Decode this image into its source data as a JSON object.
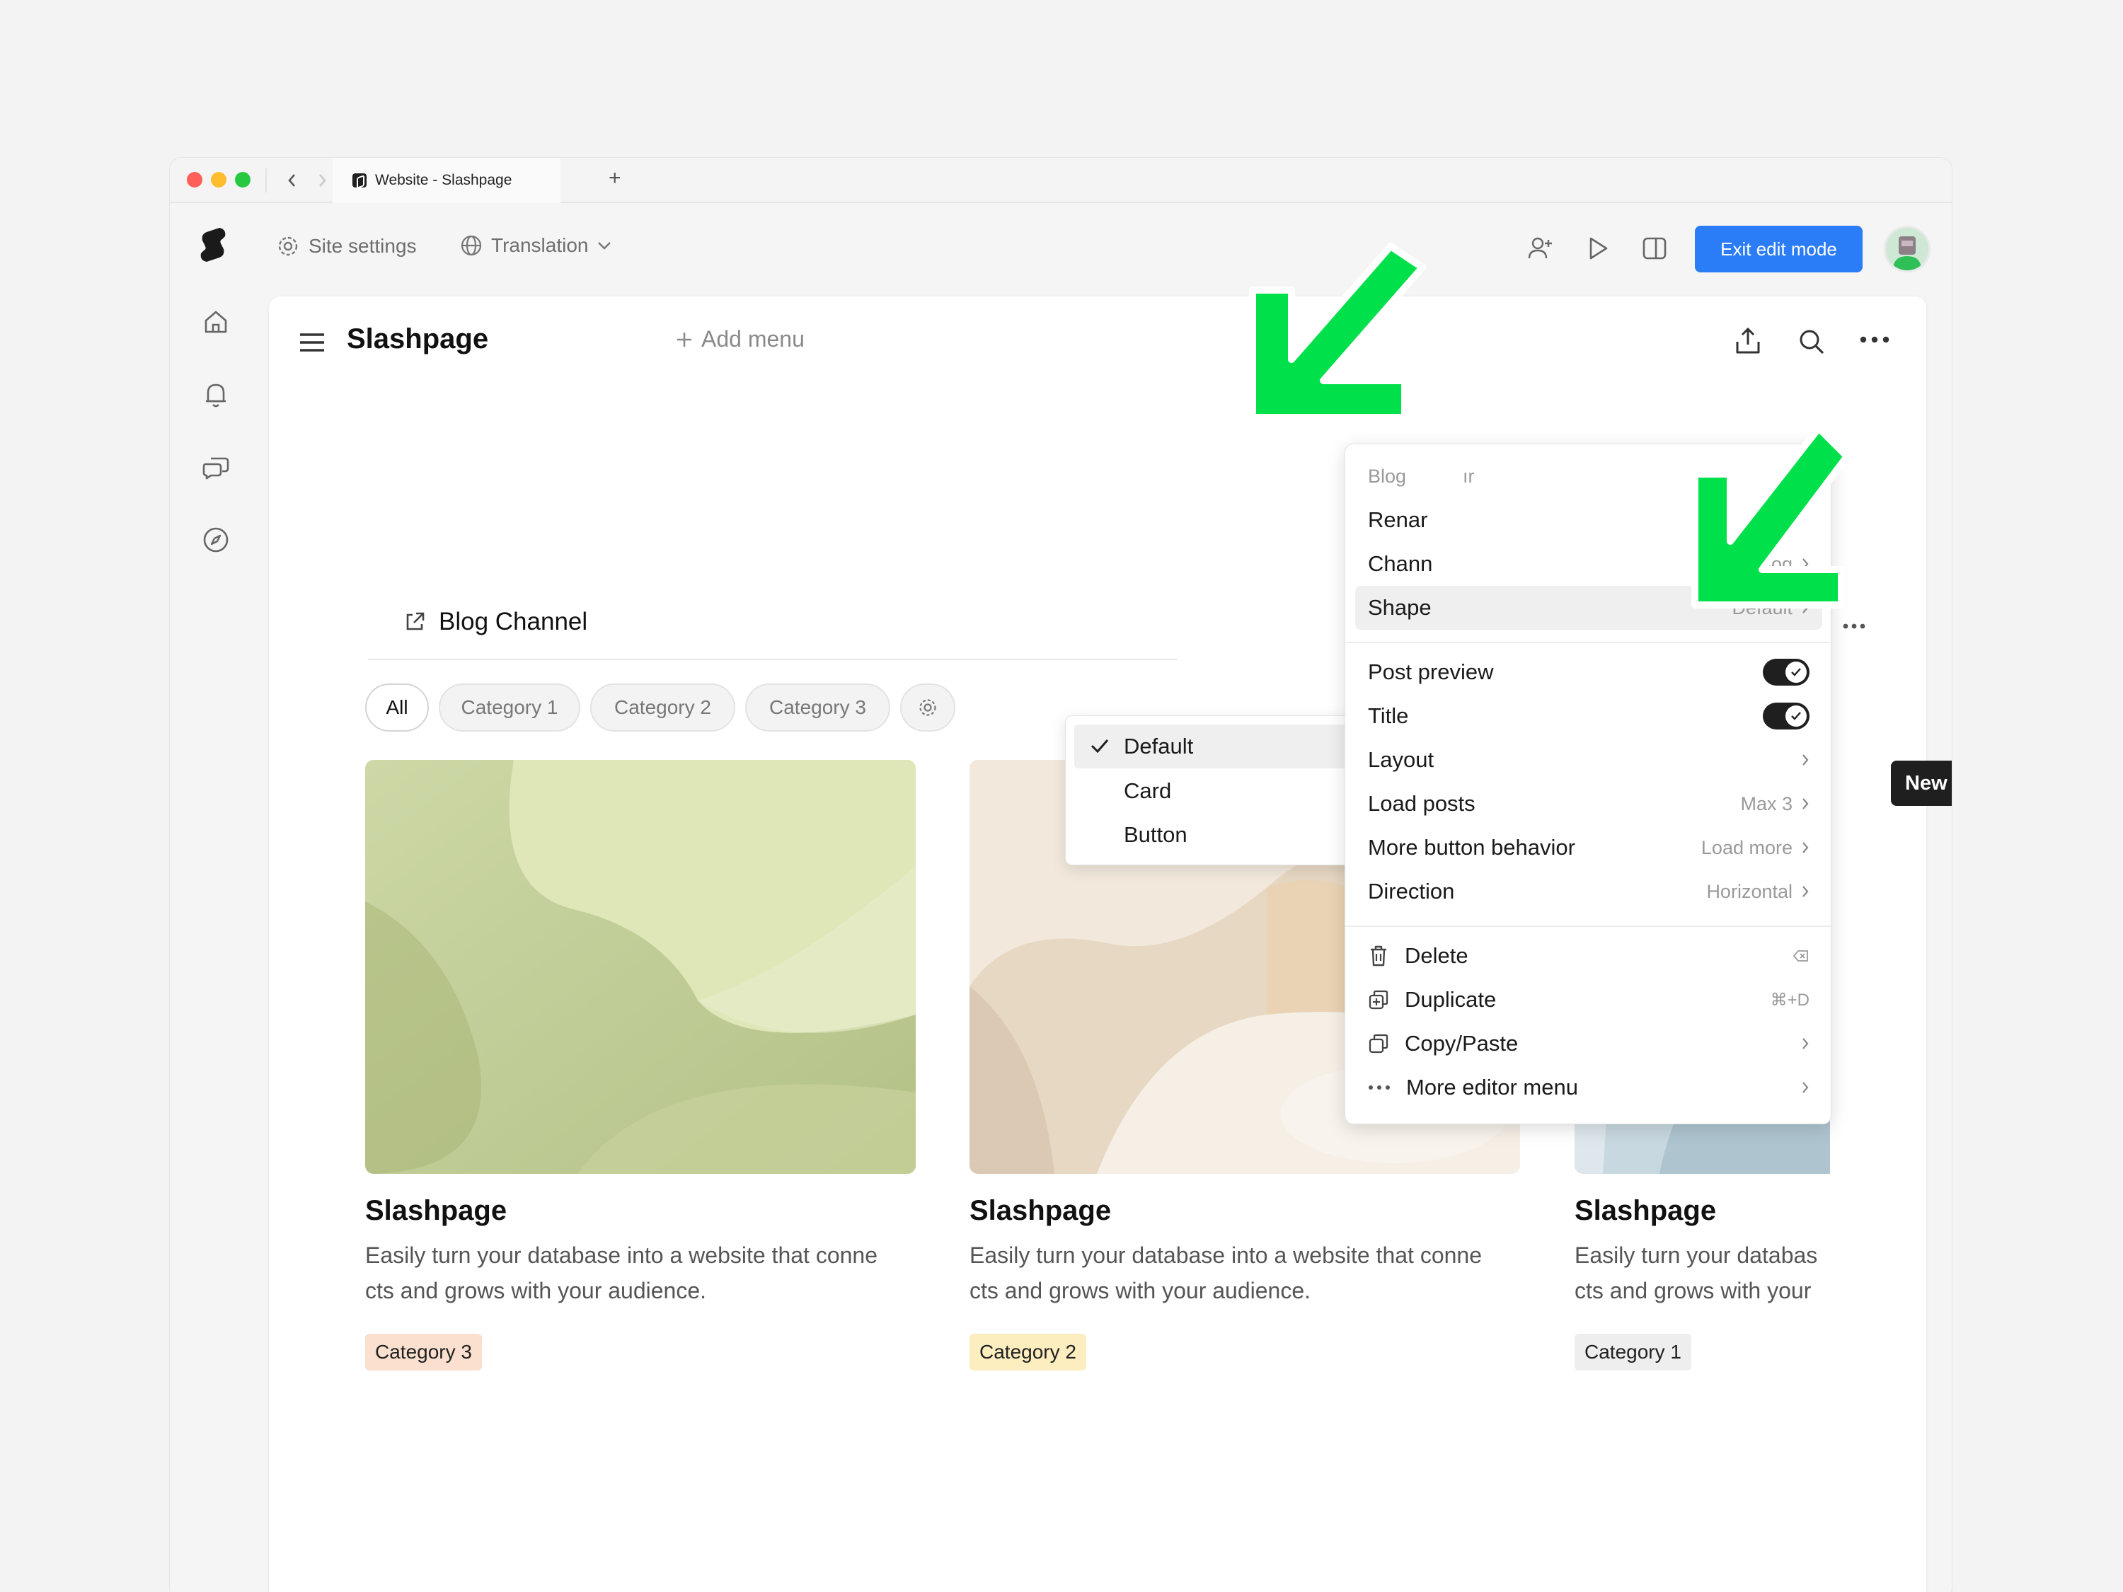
{
  "browser": {
    "tab_title": "Website - Slashpage",
    "new_tab": "+"
  },
  "toolbar": {
    "site_settings": "Site settings",
    "translation": "Translation",
    "exit_edit_mode": "Exit edit mode"
  },
  "page": {
    "title": "Slashpage",
    "add_menu": "Add menu"
  },
  "section": {
    "title": "Blog Channel",
    "new_button": "New",
    "chips": [
      "All",
      "Category 1",
      "Category 2",
      "Category 3"
    ]
  },
  "cards": [
    {
      "title": "Slashpage",
      "desc_line1": "Easily turn your database into a website that conne",
      "desc_line2": "cts and grows with your audience.",
      "badge": "Category 3",
      "badge_color": "#fbe0cf"
    },
    {
      "title": "Slashpage",
      "desc_line1": "Easily turn your database into a website that conne",
      "desc_line2": "cts and grows with your audience.",
      "badge": "Category 2",
      "badge_color": "#fdeec0"
    },
    {
      "title": "Slashpage",
      "desc_line1": "Easily turn your databas",
      "desc_line2": "cts and grows with your",
      "badge": "Category 1",
      "badge_color": "#eeeeee"
    }
  ],
  "context_menu": {
    "header": "Blog",
    "header_tail": "ır",
    "rename": "Renar",
    "channel": "Chann",
    "channel_value": "Blog",
    "shape": "Shape",
    "shape_value": "Default",
    "post_preview": "Post preview",
    "title": "Title",
    "layout": "Layout",
    "load_posts": "Load posts",
    "load_posts_value": "Max 3",
    "more_button": "More button behavior",
    "more_button_value": "Load more",
    "direction": "Direction",
    "direction_value": "Horizontal",
    "delete": "Delete",
    "duplicate": "Duplicate",
    "duplicate_shortcut": "⌘+D",
    "copy_paste": "Copy/Paste",
    "more_editor": "More editor menu"
  },
  "shape_submenu": {
    "options": [
      "Default",
      "Card",
      "Button"
    ],
    "selected": "Default"
  },
  "colors": {
    "accent": "#2a7cf7",
    "arrow": "#00e04b"
  }
}
